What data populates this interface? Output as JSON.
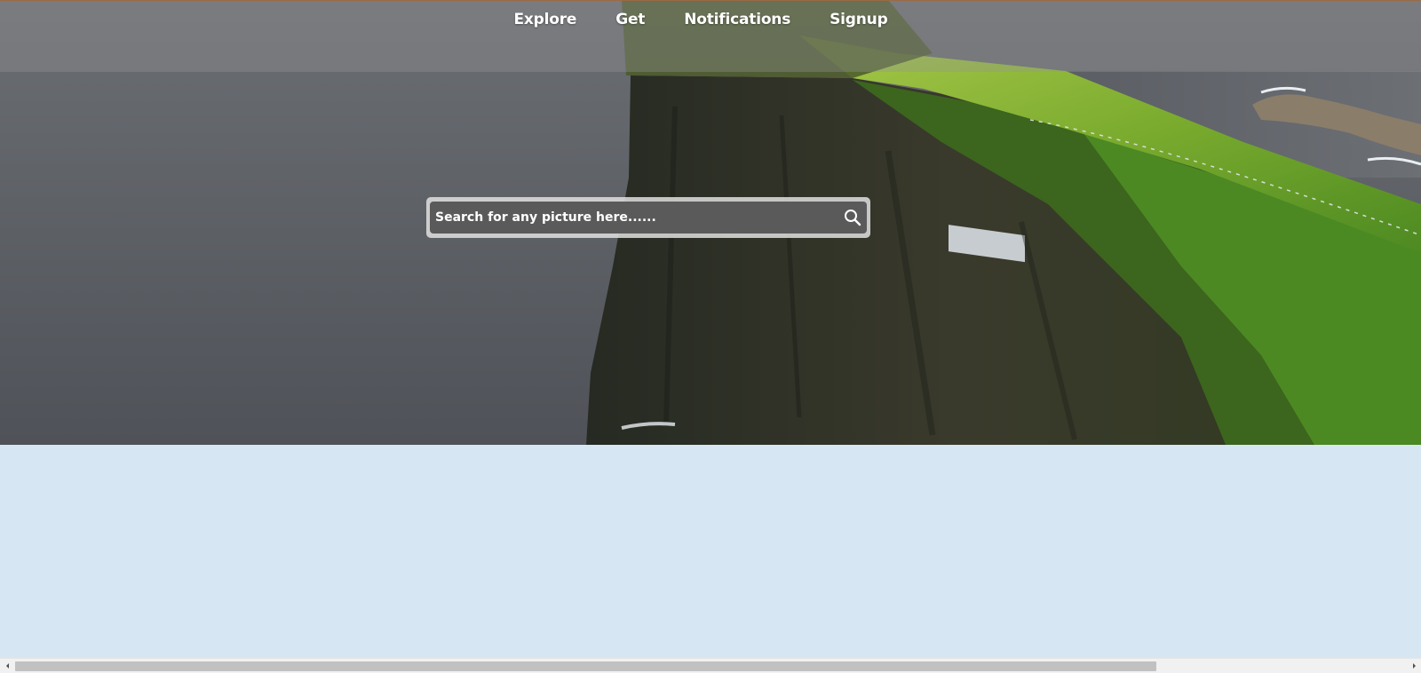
{
  "nav": {
    "items": [
      {
        "label": "Explore"
      },
      {
        "label": "Get"
      },
      {
        "label": "Notifications"
      },
      {
        "label": "Signup"
      }
    ]
  },
  "search": {
    "placeholder": "Search for any picture here......",
    "value": "",
    "icon": "search-icon"
  },
  "hero": {
    "image": "sea-cliff-landscape",
    "colors": {
      "sea": "#56595f",
      "cliff": "#2f3327",
      "grass": "#6f9e2c"
    }
  },
  "page": {
    "background": "#d6e6f3"
  },
  "scrollbar": {
    "orientation": "horizontal",
    "left_arrow_icon": "chevron-left-icon",
    "right_arrow_icon": "chevron-right-icon"
  }
}
